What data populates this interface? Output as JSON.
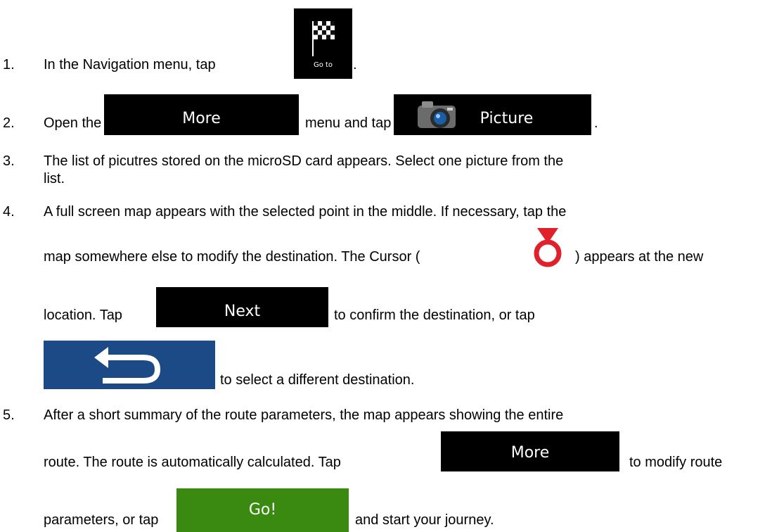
{
  "steps": [
    {
      "num": "1.",
      "text_a": "In the Navigation menu, tap",
      "text_b": "."
    },
    {
      "num": "2.",
      "text_a": "Open the",
      "text_b": "menu and tap",
      "text_c": "."
    },
    {
      "num": "3.",
      "line1": "The list of picutres stored on the microSD card appears. Select one picture from the",
      "line2": "list."
    },
    {
      "num": "4.",
      "line1": "A full screen map appears with the selected point in the middle. If necessary, tap the",
      "line2a": "map somewhere else to modify the destination. The Cursor (",
      "line2b": ") appears at the new",
      "line3a": "location. Tap",
      "line3b": "to confirm the destination, or tap",
      "line4": "to select a different destination."
    },
    {
      "num": "5.",
      "line1": "After a short summary of the route parameters, the map appears showing the entire",
      "line2a": "route. The route is automatically calculated. Tap",
      "line2b": "to modify route",
      "line3a": "parameters, or tap",
      "line3b": "and start your journey."
    }
  ],
  "buttons": {
    "goto_label": "Go to",
    "more_label": "More",
    "picture_label": "Picture",
    "next_label": "Next",
    "more2_label": "More",
    "go_label": "Go!"
  },
  "icons": {
    "goto": "checkered-flag-icon",
    "picture": "camera-icon",
    "cursor": "cursor-icon",
    "back": "back-arrow-icon"
  },
  "colors": {
    "button_black": "#000000",
    "go_green": "#3a8a12",
    "back_blue": "#1c4a86",
    "cursor_red": "#e0202a"
  }
}
